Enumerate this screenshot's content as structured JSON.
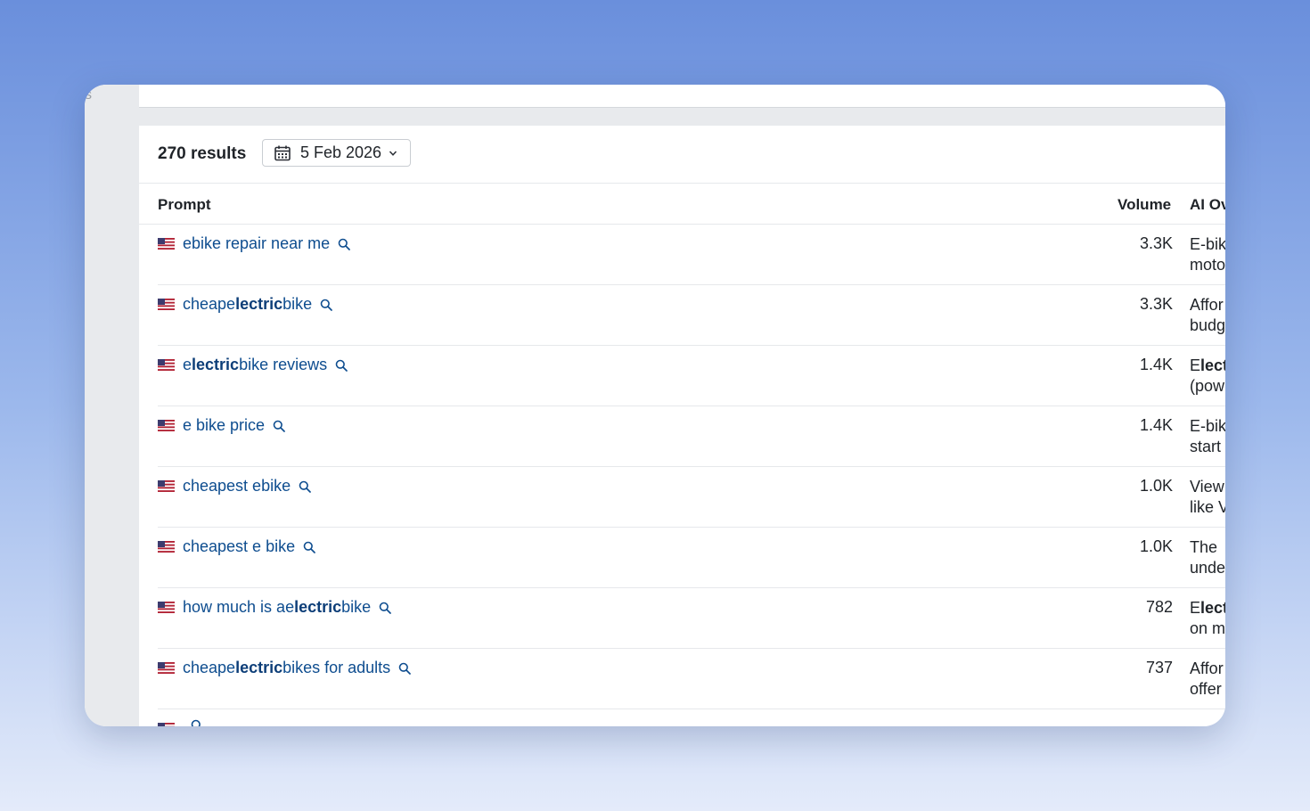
{
  "sidebar": {
    "letter": "s"
  },
  "header": {
    "faded_text": ""
  },
  "toolbar": {
    "results": "270 results",
    "date": "5 Feb 2026"
  },
  "table": {
    "columns": {
      "prompt": "Prompt",
      "volume": "Volume",
      "ai": "AI Ov"
    },
    "rows": [
      {
        "k1": "ebike repair near me",
        "k2": "",
        "k3": "",
        "k4": "",
        "volume": "3.3K",
        "ai1a": "E-bik",
        "ai1b": "",
        "ai2": "moto"
      },
      {
        "k1": "cheap ",
        "k2": "e",
        "k3": "lectric",
        "k4": " bike",
        "volume": "3.3K",
        "ai1a": "Affor",
        "ai1b": "",
        "ai2": "budg"
      },
      {
        "k1": "",
        "k2": "e",
        "k3": "lectric",
        "k4": " bike reviews",
        "volume": "1.4K",
        "ai1a": "E",
        "ai1b": "lect",
        "ai2": "(pow"
      },
      {
        "k1": "e bike price",
        "k2": "",
        "k3": "",
        "k4": "",
        "volume": "1.4K",
        "ai1a": "E-bik",
        "ai1b": "",
        "ai2": "start"
      },
      {
        "k1": "cheapest ebike",
        "k2": "",
        "k3": "",
        "k4": "",
        "volume": "1.0K",
        "ai1a": "View",
        "ai1b": "",
        "ai2": "like V"
      },
      {
        "k1": "cheapest e bike",
        "k2": "",
        "k3": "",
        "k4": "",
        "volume": "1.0K",
        "ai1a": "The ",
        "ai1b": "",
        "ai2": "unde"
      },
      {
        "k1": "how much is a ",
        "k2": "e",
        "k3": "lectric",
        "k4": " bike",
        "volume": "782",
        "ai1a": "E",
        "ai1b": "lect",
        "ai2": "on m"
      },
      {
        "k1": "cheap ",
        "k2": "e",
        "k3": "lectric",
        "k4": " bikes for adults",
        "volume": "737",
        "ai1a": "Affor",
        "ai1b": "",
        "ai2": "offer"
      },
      {
        "k1": "",
        "k2": "",
        "k3": "",
        "k4": "",
        "volume": "",
        "ai1a": "",
        "ai1b": "",
        "ai2": ""
      }
    ]
  },
  "icons": {
    "flag": "us-flag-icon",
    "search": "search-icon",
    "calendar": "calendar-icon",
    "chevron": "chevron-down-icon"
  },
  "colors": {
    "link": "#0e4d8f",
    "link_bold": "#0d3e78",
    "text": "#1f2328",
    "border": "#e6e8eb",
    "sidebar": "#e8eaed"
  }
}
